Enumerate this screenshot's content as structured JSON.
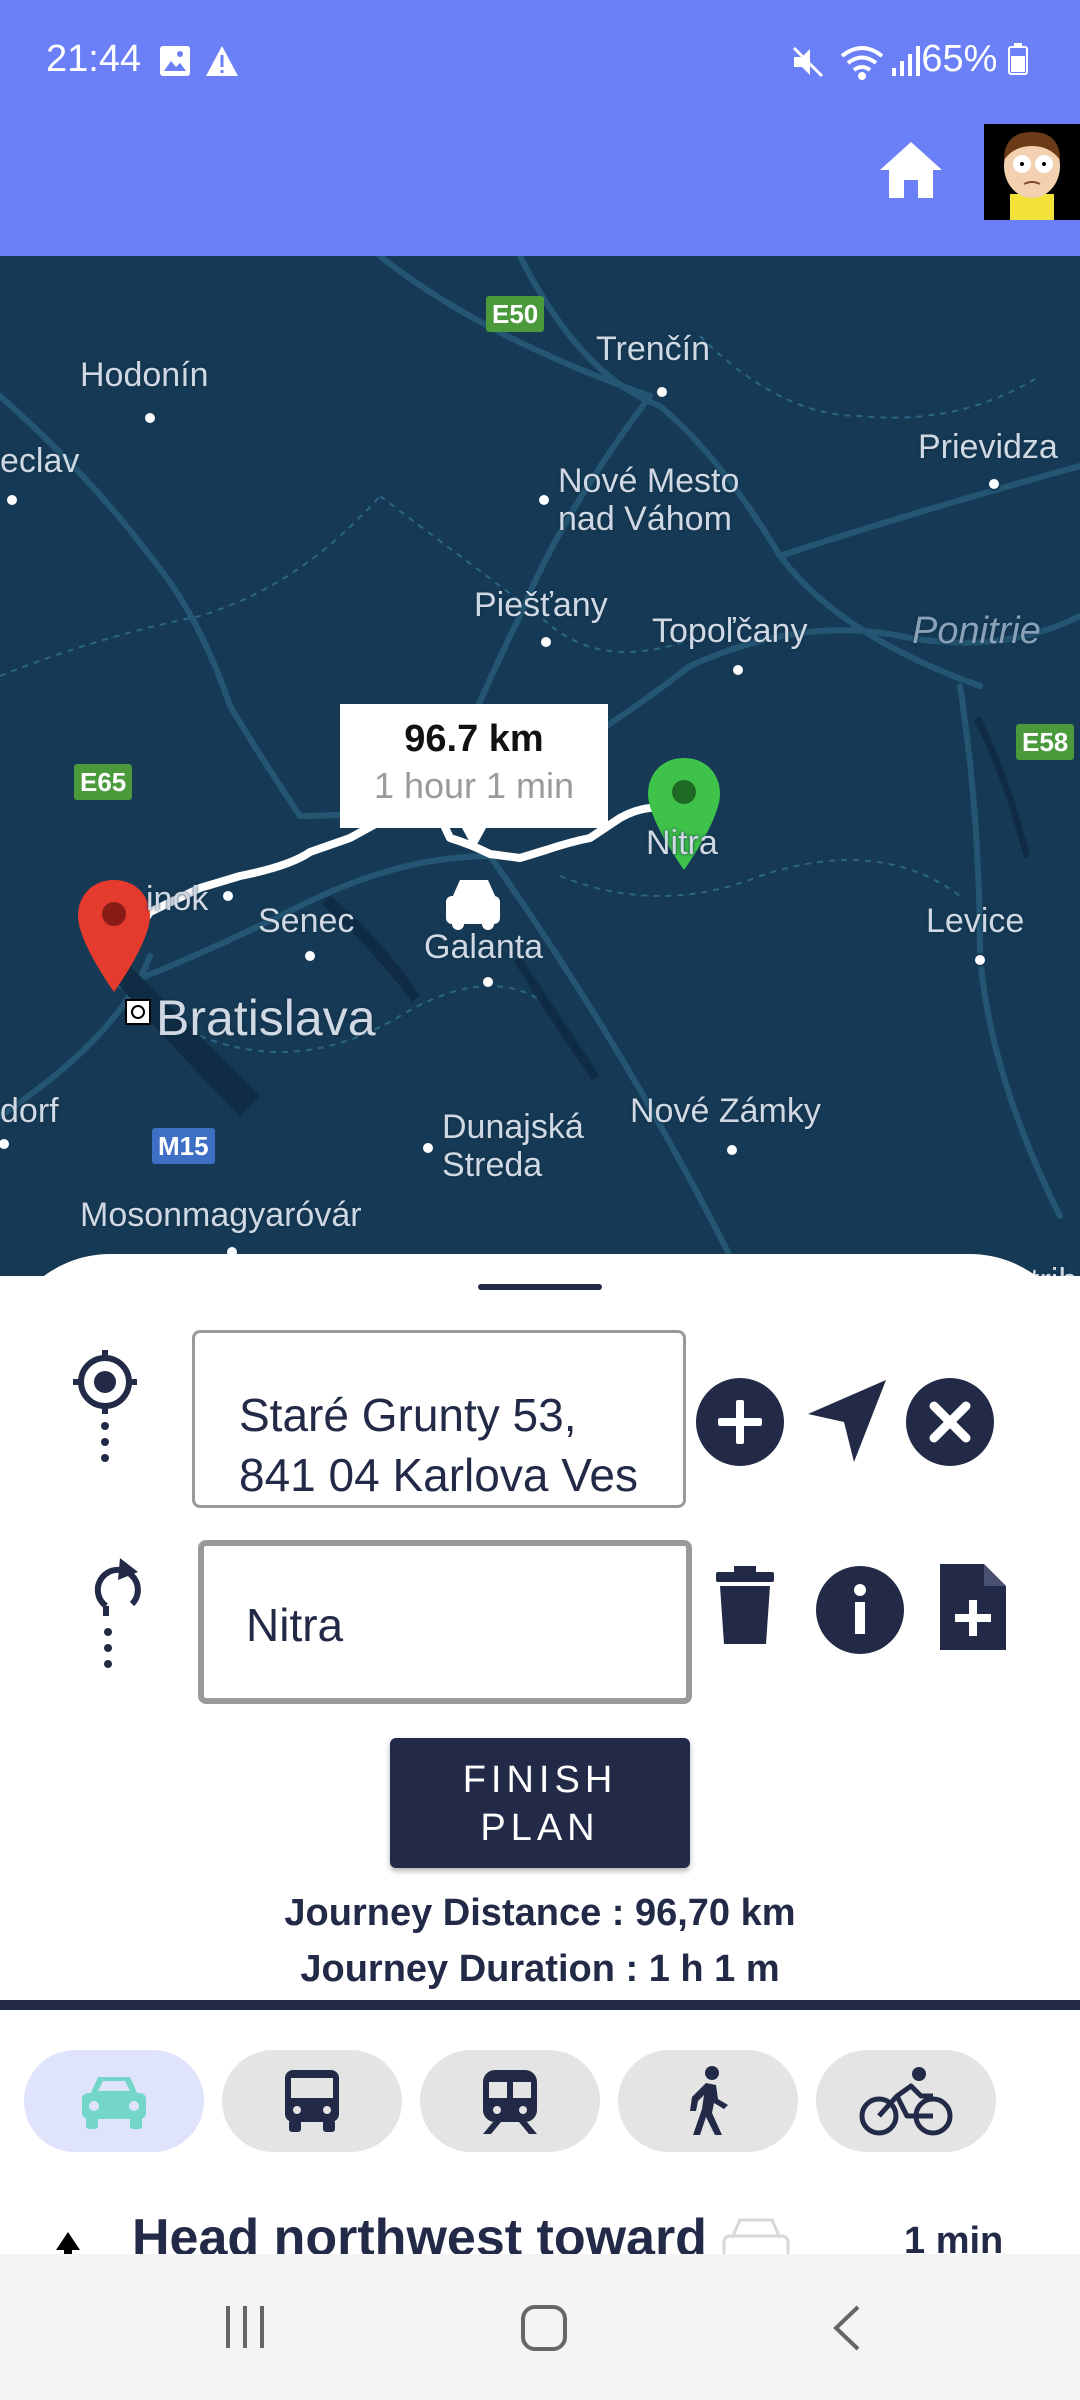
{
  "status_bar": {
    "time": "21:44",
    "battery": "65%"
  },
  "colors": {
    "app_bar": "#6b7ff7",
    "primary_dark": "#222a47",
    "map_bg": "#163a55",
    "origin_pin": "#e53b2f",
    "destination_pin": "#3fc24a",
    "car_mode_active": "#74d6c9"
  },
  "map": {
    "cities": {
      "hodonin": "Hodonín",
      "trencin": "Trenčín",
      "prievidza": "Prievidza",
      "eclav": "eclav",
      "nove_mesto": "Nové Mesto\nnad Váhom",
      "piestany": "Piešťany",
      "topolcany": "Topoľčany",
      "ponitrie": "Ponitrie",
      "nitra": "Nitra",
      "inok": "inok",
      "senec": "Senec",
      "galanta": "Galanta",
      "levice": "Levice",
      "bratislava": "Bratislava",
      "dorf": "dorf",
      "dunajska_streda": "Dunajská\nStreda",
      "nove_zamky": "Nové Zámky",
      "mosonmagyarovar": "Mosonmagyaróvár",
      "strih": "trih"
    },
    "road_shields": {
      "e50": "E50",
      "e65": "E65",
      "e58": "E58",
      "m15": "M15"
    },
    "route_tooltip": {
      "distance": "96.7 km",
      "duration": "1 hour 1 min"
    }
  },
  "planner": {
    "origin_value": "Staré Grunty 53, 841 04 Karlova Ves",
    "destination_value": "Nitra",
    "finish_button": "FINISH\nPLAN",
    "journey_distance": "Journey Distance : 96,70 km",
    "journey_duration": "Journey Duration : 1 h 1 m"
  },
  "transport_modes": {
    "selected": "car",
    "items": [
      "car",
      "bus",
      "train",
      "walk",
      "bike"
    ]
  },
  "directions": {
    "first_step": "Head northwest toward",
    "first_step_time": "1 min"
  }
}
